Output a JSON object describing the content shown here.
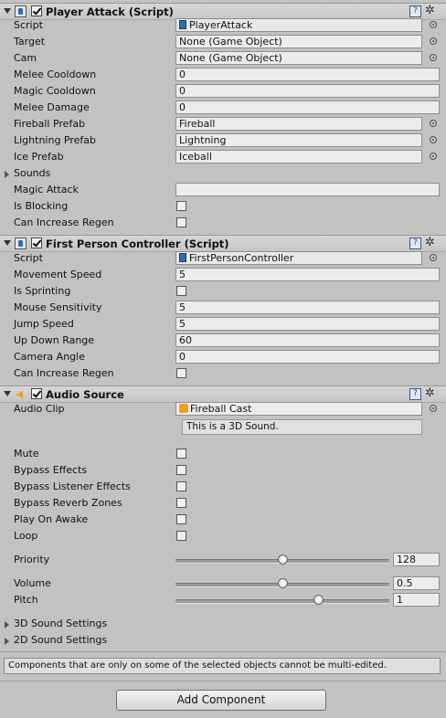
{
  "player_attack": {
    "title": "Player Attack (Script)",
    "fields": {
      "script": {
        "label": "Script",
        "value": "PlayerAttack"
      },
      "target": {
        "label": "Target",
        "value": "None (Game Object)"
      },
      "cam": {
        "label": "Cam",
        "value": "None (Game Object)"
      },
      "melee_cooldown": {
        "label": "Melee Cooldown",
        "value": "0"
      },
      "magic_cooldown": {
        "label": "Magic Cooldown",
        "value": "0"
      },
      "melee_damage": {
        "label": "Melee Damage",
        "value": "0"
      },
      "fireball_prefab": {
        "label": "Fireball Prefab",
        "value": "Fireball"
      },
      "lightning_prefab": {
        "label": "Lightning Prefab",
        "value": "Lightning"
      },
      "ice_prefab": {
        "label": "Ice Prefab",
        "value": "Iceball"
      },
      "sounds": {
        "label": "Sounds"
      },
      "magic_attack": {
        "label": "Magic Attack",
        "value": ""
      },
      "is_blocking": {
        "label": "Is Blocking",
        "checked": false
      },
      "can_increase_regen": {
        "label": "Can Increase Regen",
        "checked": false
      }
    }
  },
  "fps_controller": {
    "title": "First Person Controller (Script)",
    "fields": {
      "script": {
        "label": "Script",
        "value": "FirstPersonController"
      },
      "movement_speed": {
        "label": "Movement Speed",
        "value": "5"
      },
      "is_sprinting": {
        "label": "Is Sprinting",
        "checked": false
      },
      "mouse_sensitivity": {
        "label": "Mouse Sensitivity",
        "value": "5"
      },
      "jump_speed": {
        "label": "Jump Speed",
        "value": "5"
      },
      "up_down_range": {
        "label": "Up Down Range",
        "value": "60"
      },
      "camera_angle": {
        "label": "Camera Angle",
        "value": "0"
      },
      "can_increase_regen": {
        "label": "Can Increase Regen",
        "checked": false
      }
    }
  },
  "audio_source": {
    "title": "Audio Source",
    "fields": {
      "audio_clip": {
        "label": "Audio Clip",
        "value": "Fireball Cast"
      },
      "clip_info": "This is a 3D Sound.",
      "mute": {
        "label": "Mute",
        "checked": false
      },
      "bypass_effects": {
        "label": "Bypass Effects",
        "checked": false
      },
      "bypass_listener_effects": {
        "label": "Bypass Listener Effects",
        "checked": false
      },
      "bypass_reverb_zones": {
        "label": "Bypass Reverb Zones",
        "checked": false
      },
      "play_on_awake": {
        "label": "Play On Awake",
        "checked": false
      },
      "loop": {
        "label": "Loop",
        "checked": false
      },
      "priority": {
        "label": "Priority",
        "value": "128",
        "fraction": 0.5
      },
      "volume": {
        "label": "Volume",
        "value": "0.5",
        "fraction": 0.5
      },
      "pitch": {
        "label": "Pitch",
        "value": "1",
        "fraction": 0.667
      },
      "sound_3d": {
        "label": "3D Sound Settings"
      },
      "sound_2d": {
        "label": "2D Sound Settings"
      }
    }
  },
  "footer": {
    "note": "Components that are only on some of the selected objects cannot be multi-edited.",
    "add_component_label": "Add Component"
  },
  "icons": {
    "help": "?",
    "gear": "✲"
  },
  "colors": {
    "background": "#c2c2c2",
    "field": "#ececec",
    "script_blue": "#2b6fb3",
    "audio_orange": "#f0a020"
  }
}
